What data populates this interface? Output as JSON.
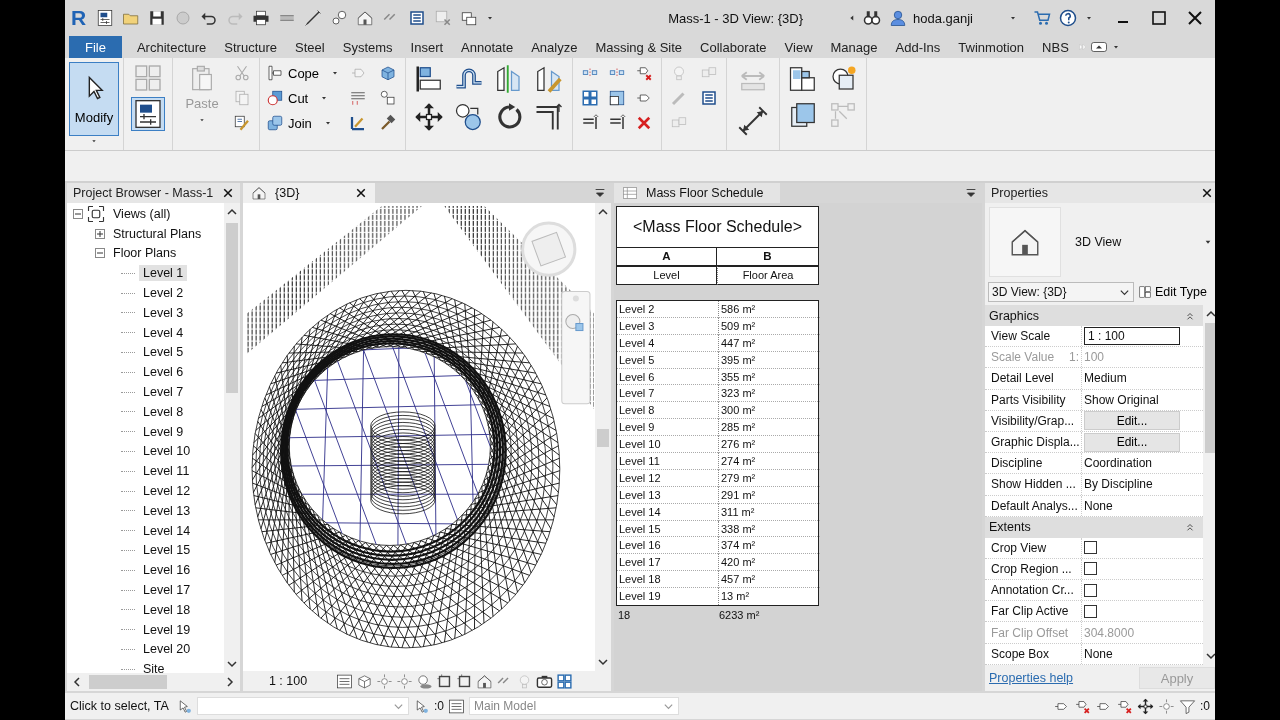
{
  "window": {
    "logo": "R",
    "title": "Mass-1 - 3D View: {3D}",
    "user": "hoda.ganji"
  },
  "ribbon_tabs": [
    {
      "label": "File",
      "kind": "file"
    },
    {
      "label": "Architecture",
      "kind": "tab"
    },
    {
      "label": "Structure",
      "kind": "tab"
    },
    {
      "label": "Steel",
      "kind": "tab"
    },
    {
      "label": "Systems",
      "kind": "tab"
    },
    {
      "label": "Insert",
      "kind": "tab"
    },
    {
      "label": "Annotate",
      "kind": "tab"
    },
    {
      "label": "Analyze",
      "kind": "tab"
    },
    {
      "label": "Massing & Site",
      "kind": "tab"
    },
    {
      "label": "Collaborate",
      "kind": "tab"
    },
    {
      "label": "View",
      "kind": "tab"
    },
    {
      "label": "Manage",
      "kind": "tab"
    },
    {
      "label": "Add-Ins",
      "kind": "tab"
    },
    {
      "label": "Twinmotion",
      "kind": "tab"
    },
    {
      "label": "NBS",
      "kind": "tab"
    }
  ],
  "ribbon": {
    "modify": {
      "label": "Modify",
      "selected": true
    },
    "paste": {
      "label": "Paste",
      "disabled": true
    },
    "geometry": [
      {
        "label": "Cope"
      },
      {
        "label": "Cut"
      },
      {
        "label": "Join"
      }
    ]
  },
  "project_browser": {
    "title": "Project Browser - Mass-1",
    "tree": [
      {
        "label": "Views (all)",
        "expanded": true,
        "selected": false,
        "children": [
          {
            "label": "Structural Plans",
            "expanded": false,
            "selected": false
          },
          {
            "label": "Floor Plans",
            "expanded": true,
            "selected": false,
            "children": [
              {
                "label": "Level 1",
                "selected": true
              },
              {
                "label": "Level 2",
                "selected": false
              },
              {
                "label": "Level 3",
                "selected": false
              },
              {
                "label": "Level 4",
                "selected": false
              },
              {
                "label": "Level 5",
                "selected": false
              },
              {
                "label": "Level 6",
                "selected": false
              },
              {
                "label": "Level 7",
                "selected": false
              },
              {
                "label": "Level 8",
                "selected": false
              },
              {
                "label": "Level 9",
                "selected": false
              },
              {
                "label": "Level 10",
                "selected": false
              },
              {
                "label": "Level 11",
                "selected": false
              },
              {
                "label": "Level 12",
                "selected": false
              },
              {
                "label": "Level 13",
                "selected": false
              },
              {
                "label": "Level 14",
                "selected": false
              },
              {
                "label": "Level 15",
                "selected": false
              },
              {
                "label": "Level 16",
                "selected": false
              },
              {
                "label": "Level 17",
                "selected": false
              },
              {
                "label": "Level 18",
                "selected": false
              },
              {
                "label": "Level 19",
                "selected": false
              },
              {
                "label": "Level 20",
                "selected": false
              },
              {
                "label": "Site",
                "selected": false
              }
            ]
          }
        ]
      }
    ]
  },
  "view_3d": {
    "tab": "{3D}",
    "scale": "1 : 100"
  },
  "schedule": {
    "tab": "Mass Floor Schedule",
    "title": "<Mass Floor Schedule>",
    "columns": [
      {
        "letter": "A",
        "header": "Level"
      },
      {
        "letter": "B",
        "header": "Floor Area"
      }
    ],
    "rows": [
      [
        "Level 2",
        "586 m²"
      ],
      [
        "Level 3",
        "509 m²"
      ],
      [
        "Level 4",
        "447 m²"
      ],
      [
        "Level 5",
        "395 m²"
      ],
      [
        "Level 6",
        "355 m²"
      ],
      [
        "Level 7",
        "323 m²"
      ],
      [
        "Level 8",
        "300 m²"
      ],
      [
        "Level 9",
        "285 m²"
      ],
      [
        "Level 10",
        "276 m²"
      ],
      [
        "Level 11",
        "274 m²"
      ],
      [
        "Level 12",
        "279 m²"
      ],
      [
        "Level 13",
        "291 m²"
      ],
      [
        "Level 14",
        "311 m²"
      ],
      [
        "Level 15",
        "338 m²"
      ],
      [
        "Level 16",
        "374 m²"
      ],
      [
        "Level 17",
        "420 m²"
      ],
      [
        "Level 18",
        "457 m²"
      ],
      [
        "Level 19",
        "13 m²"
      ]
    ],
    "totals": [
      "18",
      "6233 m²"
    ]
  },
  "properties": {
    "title": "Properties",
    "type_name": "3D View",
    "instance": "3D View: {3D}",
    "edit_type": "Edit Type",
    "sections": [
      {
        "name": "Graphics",
        "rows": [
          {
            "label": "View Scale",
            "kind": "input",
            "value": "1 : 100"
          },
          {
            "label": "Scale Value",
            "kind": "text",
            "unit": "1:",
            "value": "100",
            "disabled": true
          },
          {
            "label": "Detail Level",
            "kind": "text",
            "value": "Medium",
            "disabled": false
          },
          {
            "label": "Parts Visibility",
            "kind": "text",
            "value": "Show Original",
            "disabled": false
          },
          {
            "label": "Visibility/Grap...",
            "kind": "button",
            "value": "Edit..."
          },
          {
            "label": "Graphic Displa...",
            "kind": "button",
            "value": "Edit..."
          },
          {
            "label": "Discipline",
            "kind": "text",
            "value": "Coordination",
            "disabled": false
          },
          {
            "label": "Show Hidden ...",
            "kind": "text",
            "value": "By Discipline",
            "disabled": false
          },
          {
            "label": "Default Analys...",
            "kind": "text",
            "value": "None",
            "disabled": false
          }
        ]
      },
      {
        "name": "Extents",
        "rows": [
          {
            "label": "Crop View",
            "kind": "checkbox",
            "checked": false
          },
          {
            "label": "Crop Region ...",
            "kind": "checkbox",
            "checked": false
          },
          {
            "label": "Annotation Cr...",
            "kind": "checkbox",
            "checked": false
          },
          {
            "label": "Far Clip Active",
            "kind": "checkbox",
            "checked": false
          },
          {
            "label": "Far Clip Offset",
            "kind": "text",
            "value": "304.8000",
            "disabled": true
          },
          {
            "label": "Scope Box",
            "kind": "text",
            "value": "None",
            "disabled": false
          }
        ]
      }
    ],
    "help": "Properties help",
    "apply": {
      "label": "Apply",
      "disabled": true
    }
  },
  "status_bar": {
    "prompt": "Click to select, TA",
    "counter_1": ":0",
    "workset": "Main Model",
    "counter_2": ":0"
  }
}
